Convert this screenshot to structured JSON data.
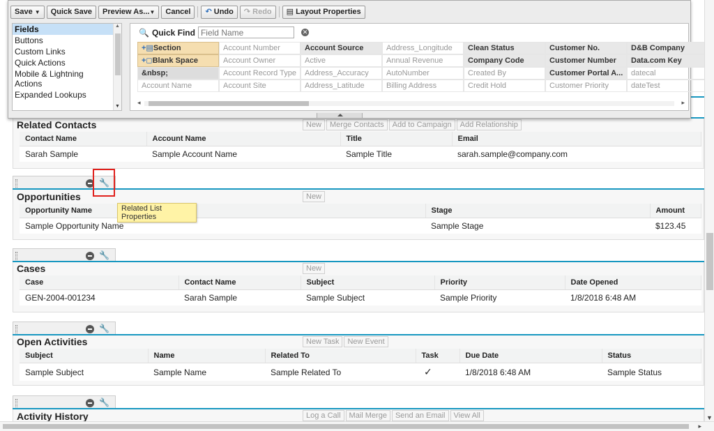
{
  "toolbar": {
    "save": "Save",
    "save_dropdown": "▼",
    "quick_save": "Quick Save",
    "preview_as": "Preview As...",
    "preview_dropdown": "▼",
    "cancel": "Cancel",
    "undo": "Undo",
    "redo": "Redo",
    "layout_properties": "Layout Properties"
  },
  "categories": [
    "Fields",
    "Buttons",
    "Custom Links",
    "Quick Actions",
    "Mobile & Lightning Actions",
    "Expanded Lookups"
  ],
  "quick_find": {
    "label": "Quick Find",
    "placeholder": "Field Name"
  },
  "fields": [
    {
      "label": "Section",
      "style": "section",
      "icon": "+▤"
    },
    {
      "label": "Account Number",
      "style": "unused"
    },
    {
      "label": "Account Source",
      "style": "used"
    },
    {
      "label": "Address_Longitude",
      "style": "unused"
    },
    {
      "label": "Clean Status",
      "style": "used"
    },
    {
      "label": "Customer No.",
      "style": "used"
    },
    {
      "label": "D&B Company",
      "style": "used"
    },
    {
      "label": "Blank Space",
      "style": "section",
      "icon": "+◻"
    },
    {
      "label": "Account Owner",
      "style": "unused"
    },
    {
      "label": "Active",
      "style": "unused"
    },
    {
      "label": "Annual Revenue",
      "style": "unused"
    },
    {
      "label": "Company Code",
      "style": "used"
    },
    {
      "label": "Customer Number",
      "style": "used"
    },
    {
      "label": "Data.com Key",
      "style": "used"
    },
    {
      "label": "&nbsp;",
      "style": "nbsp"
    },
    {
      "label": "Account Record Type",
      "style": "unused"
    },
    {
      "label": "Address_Accuracy",
      "style": "unused"
    },
    {
      "label": "AutoNumber",
      "style": "unused"
    },
    {
      "label": "Created By",
      "style": "unused"
    },
    {
      "label": "Customer Portal A...",
      "style": "used"
    },
    {
      "label": "datecal",
      "style": "unused"
    },
    {
      "label": "Account Name",
      "style": "unused"
    },
    {
      "label": "Account Site",
      "style": "unused"
    },
    {
      "label": "Address_Latitude",
      "style": "unused"
    },
    {
      "label": "Billing Address",
      "style": "unused"
    },
    {
      "label": "Credit Hold",
      "style": "unused"
    },
    {
      "label": "Customer Priority",
      "style": "unused"
    },
    {
      "label": "dateTest",
      "style": "unused"
    }
  ],
  "related_contacts": {
    "title": "Related Contacts",
    "buttons": [
      "New",
      "Merge Contacts",
      "Add to Campaign",
      "Add Relationship"
    ],
    "columns": [
      "Contact Name",
      "Account Name",
      "Title",
      "Email"
    ],
    "row": [
      "Sarah Sample",
      "Sample Account Name",
      "Sample Title",
      "sarah.sample@company.com"
    ]
  },
  "opportunities": {
    "title": "Opportunities",
    "buttons": [
      "New"
    ],
    "columns": [
      "Opportunity Name",
      "Stage",
      "Amount"
    ],
    "row": [
      "Sample Opportunity Name",
      "Sample Stage",
      "$123.45"
    ]
  },
  "tooltip": "Related List Properties",
  "cases": {
    "title": "Cases",
    "buttons": [
      "New"
    ],
    "columns": [
      "Case",
      "Contact Name",
      "Subject",
      "Priority",
      "Date Opened"
    ],
    "row": [
      "GEN-2004-001234",
      "Sarah Sample",
      "Sample Subject",
      "Sample Priority",
      "1/8/2018 6:48 AM"
    ]
  },
  "open_activities": {
    "title": "Open Activities",
    "buttons": [
      "New Task",
      "New Event"
    ],
    "columns": [
      "Subject",
      "Name",
      "Related To",
      "Task",
      "Due Date",
      "Status"
    ],
    "row": [
      "Sample Subject",
      "Sample Name",
      "Sample Related To",
      "✓",
      "1/8/2018 6:48 AM",
      "Sample Status"
    ]
  },
  "activity_history": {
    "title": "Activity History",
    "buttons": [
      "Log a Call",
      "Mail Merge",
      "Send an Email",
      "View All"
    ]
  }
}
